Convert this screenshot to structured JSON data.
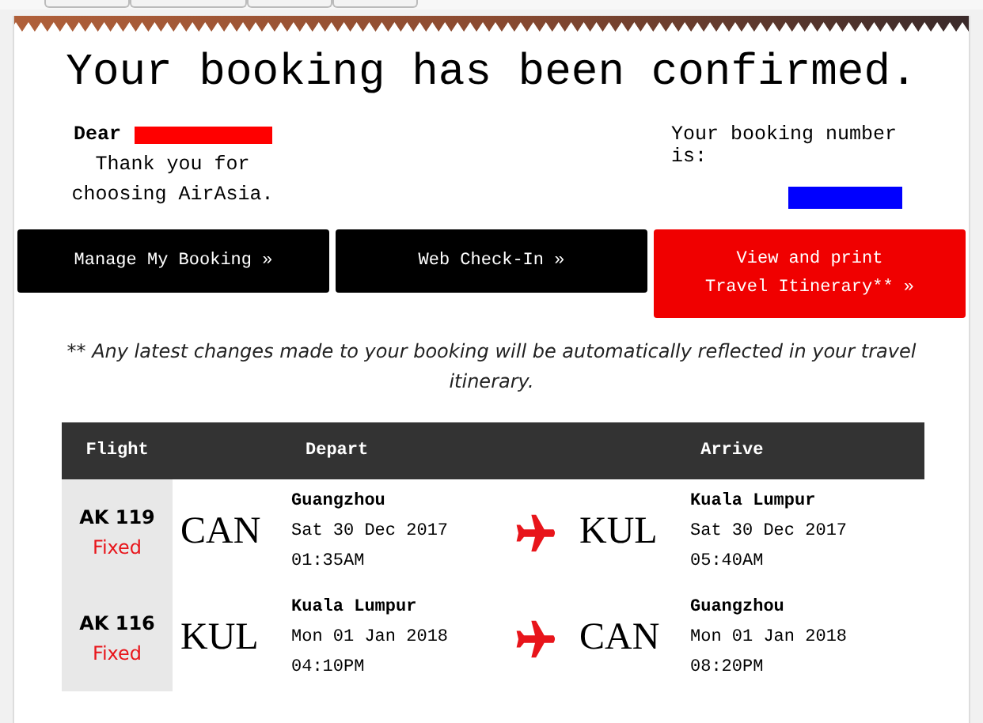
{
  "title": "Your booking has been confirmed.",
  "greeting": {
    "salutation": "Dear",
    "message": "Thank you for choosing AirAsia."
  },
  "booking_number": {
    "label": "Your booking number is:"
  },
  "buttons": [
    {
      "lines": [
        "Manage My Booking »"
      ],
      "kind": "primary"
    },
    {
      "lines": [
        "Web Check-In »"
      ],
      "kind": "primary"
    },
    {
      "lines": [
        "View and print",
        "Travel Itinerary** »"
      ],
      "kind": "highlight"
    }
  ],
  "note": "** Any latest changes made to your booking will be automatically reflected in your travel itinerary.",
  "table": {
    "columns": [
      "Flight",
      "Depart",
      "Arrive"
    ],
    "rows": [
      {
        "flight": "AK 119",
        "status": "Fixed",
        "depart": {
          "code": "CAN",
          "city": "Guangzhou",
          "date": "Sat 30 Dec 2017",
          "time": "01:35AM"
        },
        "arrive": {
          "code": "KUL",
          "city": "Kuala Lumpur",
          "date": "Sat 30 Dec 2017",
          "time": "05:40AM"
        }
      },
      {
        "flight": "AK 116",
        "status": "Fixed",
        "depart": {
          "code": "KUL",
          "city": "Kuala Lumpur",
          "date": "Mon 01 Jan 2018",
          "time": "04:10PM"
        },
        "arrive": {
          "code": "CAN",
          "city": "Guangzhou",
          "date": "Mon 01 Jan 2018",
          "time": "08:20PM"
        }
      }
    ]
  }
}
